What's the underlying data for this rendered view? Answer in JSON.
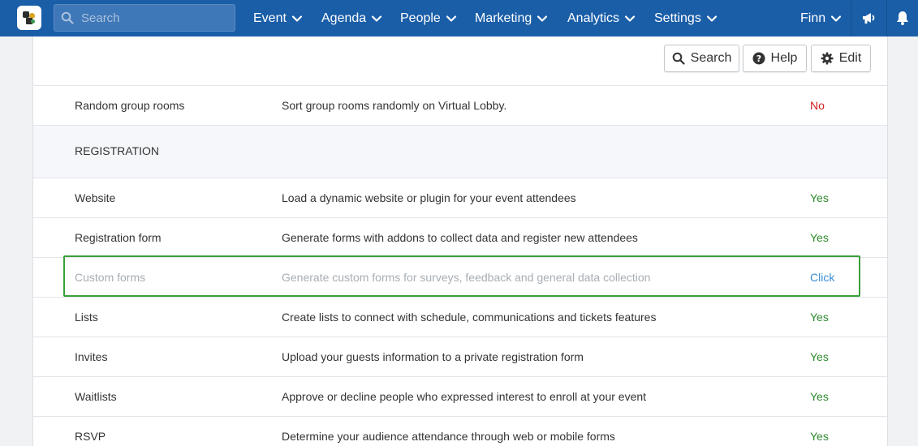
{
  "topbar": {
    "search_placeholder": "Search",
    "nav": [
      "Event",
      "Agenda",
      "People",
      "Marketing",
      "Analytics",
      "Settings"
    ],
    "user": "Finn",
    "bg_color": "#1a5ea8"
  },
  "toolbar": {
    "search_label": "Search",
    "help_label": "Help",
    "edit_label": "Edit"
  },
  "rows": [
    {
      "name": "Random group rooms",
      "desc": "Sort group rooms randomly on Virtual Lobby.",
      "value": "No"
    },
    {
      "section": "REGISTRATION"
    },
    {
      "name": "Website",
      "desc": "Load a dynamic website or plugin for your event attendees",
      "value": "Yes"
    },
    {
      "name": "Registration form",
      "desc": "Generate forms with addons to collect data and register new attendees",
      "value": "Yes"
    },
    {
      "name": "Custom forms",
      "desc": "Generate custom forms for surveys, feedback and general data collection",
      "value": "Click"
    },
    {
      "name": "Lists",
      "desc": "Create lists to connect with schedule, communications and tickets features",
      "value": "Yes"
    },
    {
      "name": "Invites",
      "desc": "Upload your guests information to a private registration form",
      "value": "Yes"
    },
    {
      "name": "Waitlists",
      "desc": "Approve or decline people who expressed interest to enroll at your event",
      "value": "Yes"
    },
    {
      "name": "RSVP",
      "desc": "Determine your audience attendance through web or mobile forms",
      "value": "Yes"
    }
  ],
  "colors": {
    "yes": "#2d8a2d",
    "no": "#d11f1f",
    "click": "#3a8ed6",
    "highlight": "#3aa03a"
  }
}
